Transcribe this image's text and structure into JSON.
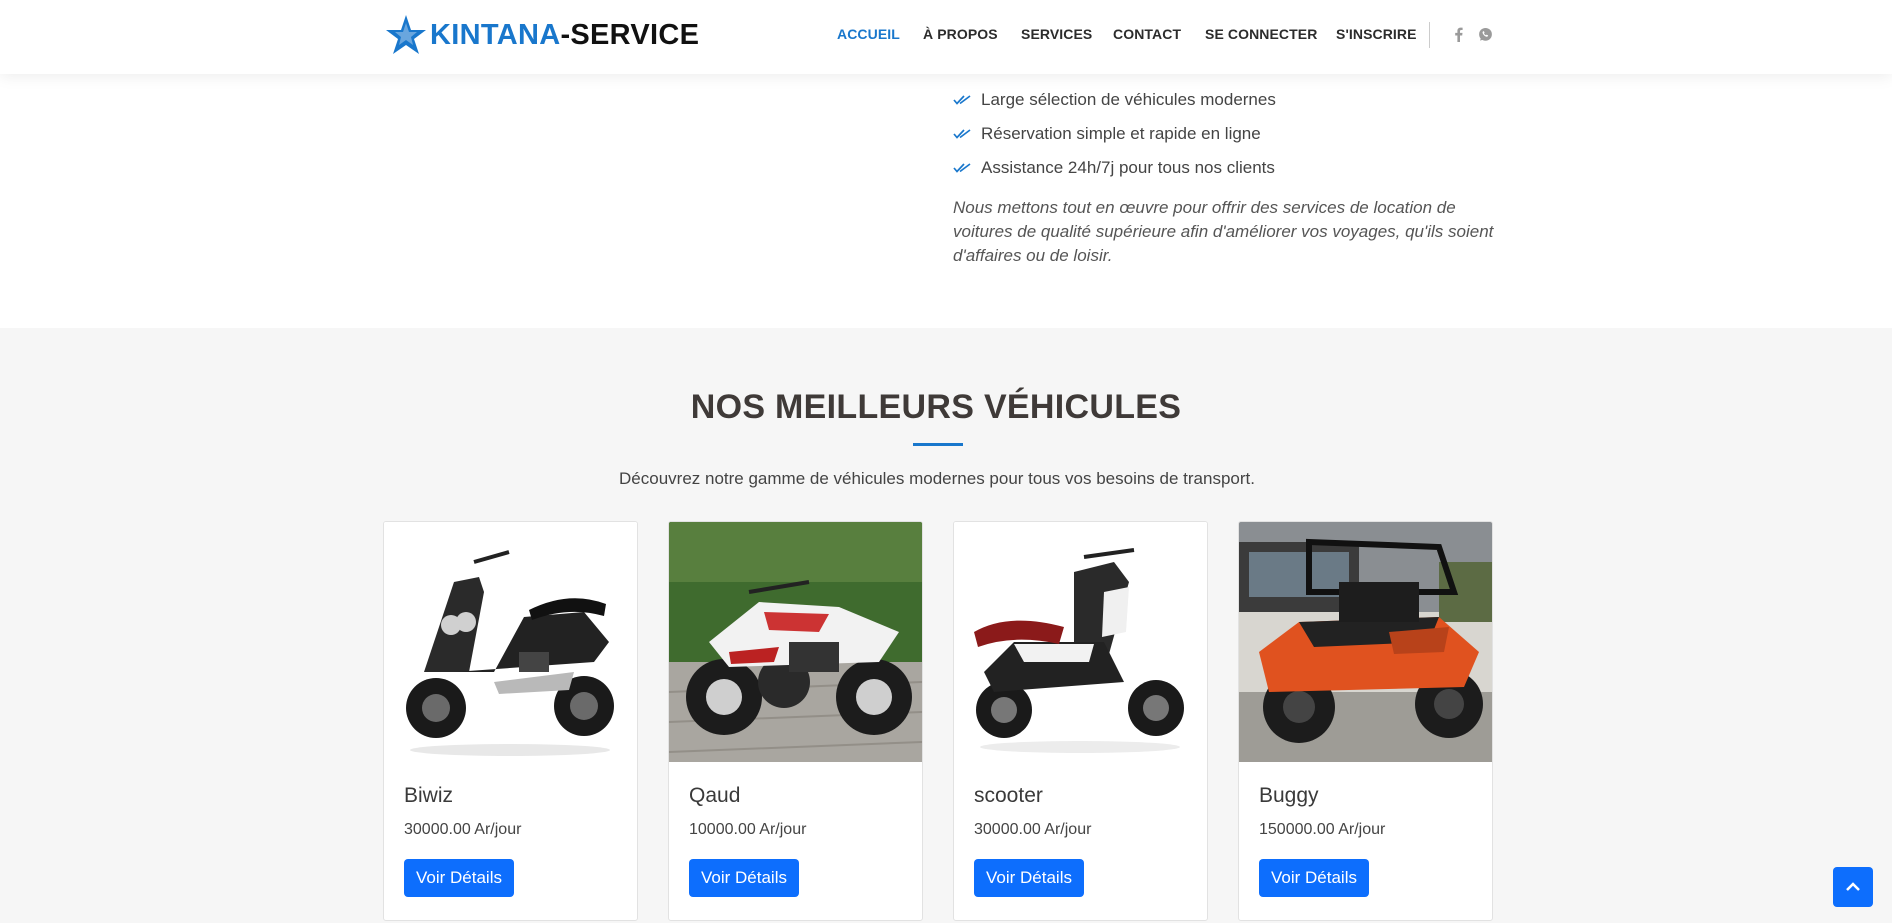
{
  "header": {
    "logo_part_1": "KINTANA",
    "logo_part_2": "-SERVICE",
    "nav": [
      "ACCUEIL",
      "À PROPOS",
      "SERVICES",
      "CONTACT",
      "SE CONNECTER",
      "S'INSCRIRE"
    ],
    "active_nav": "ACCUEIL",
    "social_icons": [
      "facebook-icon",
      "whatsapp-icon"
    ]
  },
  "about": {
    "checks": [
      "Large sélection de véhicules modernes",
      "Réservation simple et rapide en ligne",
      "Assistance 24h/7j pour tous nos clients"
    ],
    "quote": "Nous mettons tout en œuvre pour offrir des services de location de voitures de qualité supérieure afin d'améliorer vos voyages, qu'ils soient d'affaires ou de loisir."
  },
  "vehicles": {
    "title": "NOS MEILLEURS VÉHICULES",
    "subtitle": "Découvrez notre gamme de véhicules modernes pour tous vos besoins de transport.",
    "cards": [
      {
        "name": "Biwiz",
        "price": "30000.00 Ar/jour",
        "button": "Voir Détails"
      },
      {
        "name": "Qaud",
        "price": "10000.00 Ar/jour",
        "button": "Voir Détails"
      },
      {
        "name": "scooter",
        "price": "30000.00 Ar/jour",
        "button": "Voir Détails"
      },
      {
        "name": "Buggy",
        "price": "150000.00 Ar/jour",
        "button": "Voir Détails"
      }
    ]
  },
  "colors": {
    "accent": "#1977cc",
    "button": "#0d6efd",
    "section_bg": "#f6f6f6",
    "heading": "#3f3a38"
  },
  "icons": {
    "back_to_top": "chevron-up-icon",
    "check": "double-check-icon"
  }
}
